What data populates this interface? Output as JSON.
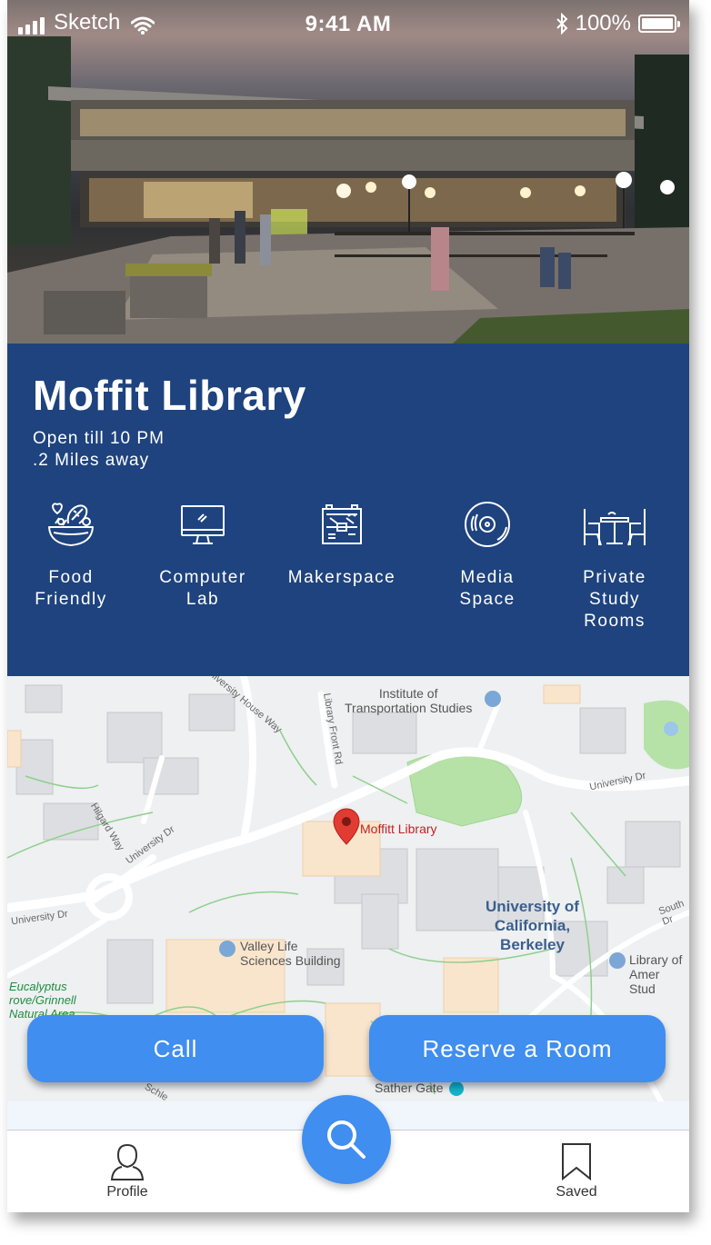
{
  "status_bar": {
    "carrier": "Sketch",
    "time": "9:41 AM",
    "battery": "100%"
  },
  "place": {
    "name": "Moffit Library",
    "hours": "Open till 10 PM",
    "distance": ".2 Miles away"
  },
  "amenities": [
    {
      "icon": "food-bowl-icon",
      "label": "Food\nFriendly"
    },
    {
      "icon": "computer-monitor-icon",
      "label": "Computer\nLab"
    },
    {
      "icon": "toolbox-icon",
      "label": "Makerspace"
    },
    {
      "icon": "disc-icon",
      "label": "Media\nSpace"
    },
    {
      "icon": "study-table-icon",
      "label": "Private\nStudy\nRooms"
    }
  ],
  "map": {
    "pin_label": "Moffitt Library",
    "labels": {
      "institute": "Institute of\nTransportation Studies",
      "campus": "University of\nCalifornia,\nBerkeley",
      "valley": "Valley Life\nSciences Building",
      "amer": "Library of\nAmer Stud",
      "eucalyptus": "Eucalyptus\nrove/Grinnell\nNatural Area",
      "sather": "Sather Gate",
      "univ_dr_left": "University Dr",
      "univ_dr_mid": "University Dr",
      "univ_dr_right": "University Dr",
      "hilgard": "Hilgard Way",
      "house_way": "University House Way",
      "library_front": "Library Front Rd",
      "south_dr": "South Dr",
      "schle": "Schle"
    },
    "colors": {
      "pin": "#e13c32",
      "pin_text": "#c5221f",
      "campus_text": "#3b5f8c",
      "green": "#a8dc9b",
      "building": "#f8e6cf"
    }
  },
  "actions": {
    "call": "Call",
    "reserve": "Reserve a Room"
  },
  "tabbar": {
    "profile": "Profile",
    "saved": "Saved"
  },
  "colors": {
    "panel": "#1e437e",
    "accent": "#3f8ef0"
  }
}
